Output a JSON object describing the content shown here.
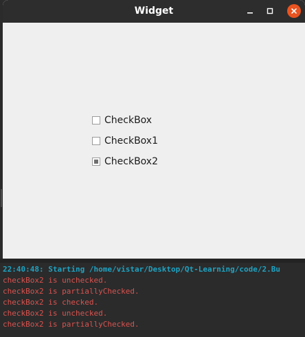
{
  "window": {
    "title": "Widget"
  },
  "checkboxes": [
    {
      "label": "CheckBox",
      "state": "unchecked"
    },
    {
      "label": "CheckBox1",
      "state": "unchecked"
    },
    {
      "label": "CheckBox2",
      "state": "partiallyChecked"
    }
  ],
  "console": {
    "lines": [
      {
        "text": "22:40:48: Starting /home/vistar/Desktop/Qt-Learning/code/2.Bu",
        "kind": "start"
      },
      {
        "text": "checkBox2 is unchecked.",
        "kind": "out"
      },
      {
        "text": "checkBox2 is partiallyChecked.",
        "kind": "out"
      },
      {
        "text": "checkBox2 is checked.",
        "kind": "out"
      },
      {
        "text": "checkBox2 is unchecked.",
        "kind": "out"
      },
      {
        "text": "checkBox2 is partiallyChecked.",
        "kind": "out"
      }
    ]
  },
  "colors": {
    "titlebar": "#2d2d2d",
    "window_bg": "#efefef",
    "close_button": "#e95420",
    "console_bg": "#2b2b2b",
    "console_start_text": "#1fa2c1",
    "console_output_text": "#d9534f"
  }
}
